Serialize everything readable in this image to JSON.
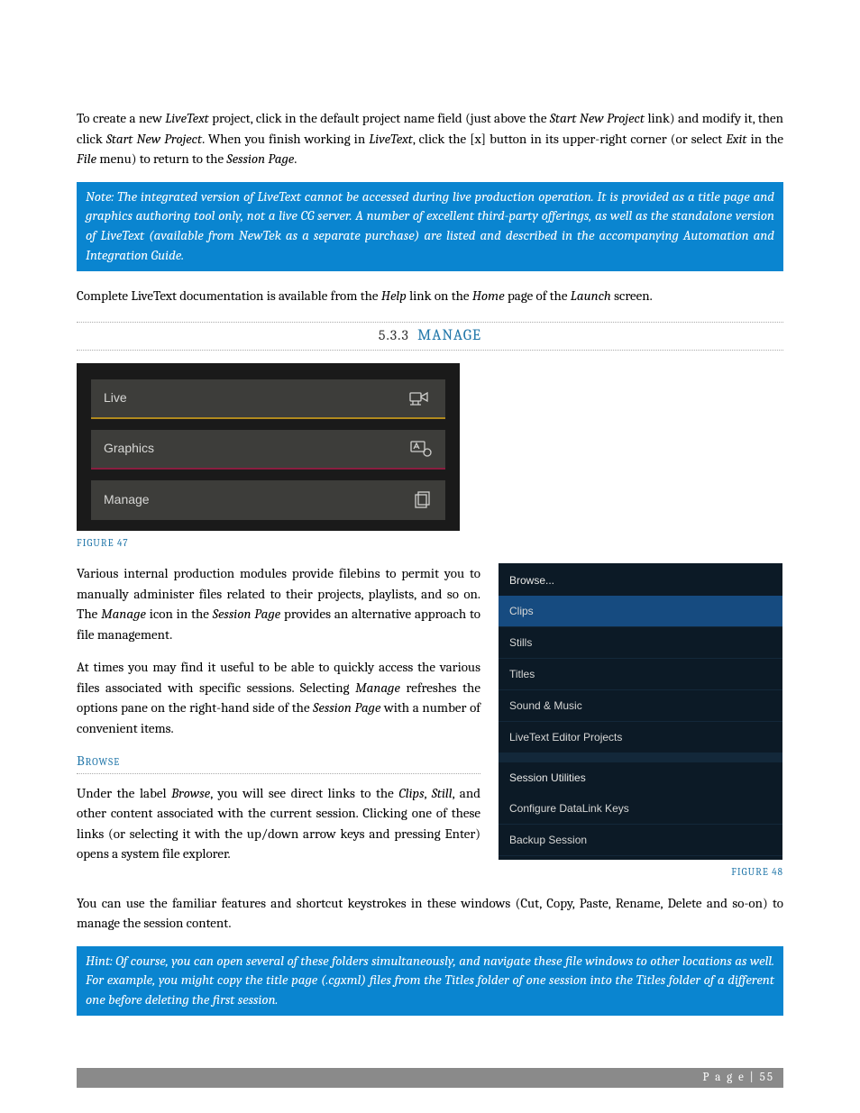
{
  "para1_parts": [
    {
      "t": "To create a new "
    },
    {
      "t": "LiveText",
      "i": true
    },
    {
      "t": " project, click in the default project name field (just above the "
    },
    {
      "t": "Start New Project",
      "i": true
    },
    {
      "t": " link) and modify it, then click "
    },
    {
      "t": "Start New Project",
      "i": true
    },
    {
      "t": ".  When you finish working in "
    },
    {
      "t": "LiveText",
      "i": true
    },
    {
      "t": ", click the [x] button in its upper-right corner (or select "
    },
    {
      "t": "Exit",
      "i": true
    },
    {
      "t": " in the "
    },
    {
      "t": "File",
      "i": true
    },
    {
      "t": " menu) to return to the "
    },
    {
      "t": "Session Page",
      "i": true
    },
    {
      "t": "."
    }
  ],
  "note1": "Note: The integrated version of LiveText cannot be accessed during live production operation.  It is provided as a title page and graphics authoring tool only, not a live CG server. A number of excellent third-party offerings, as well as the standalone version of LiveText (available from NewTek as a separate purchase) are listed and described in the accompanying Automation and Integration Guide.",
  "para2_parts": [
    {
      "t": "Complete LiveText documentation is available from the "
    },
    {
      "t": "Help",
      "i": true
    },
    {
      "t": " link on the "
    },
    {
      "t": "Home",
      "i": true
    },
    {
      "t": " page of the "
    },
    {
      "t": "Launch",
      "i": true
    },
    {
      "t": " screen."
    }
  ],
  "section": {
    "num": "5.3.3",
    "title": "MANAGE"
  },
  "fig47": {
    "rows": [
      {
        "label": "Live",
        "icon": "camera"
      },
      {
        "label": "Graphics",
        "icon": "graphics"
      },
      {
        "label": "Manage",
        "icon": "files"
      }
    ],
    "caption": "FIGURE 47"
  },
  "para3_parts": [
    {
      "t": "Various internal production modules provide filebins to permit you to manually administer files related to their projects, playlists, and so on.  The "
    },
    {
      "t": "Manage",
      "i": true
    },
    {
      "t": " icon in the "
    },
    {
      "t": "Session Page",
      "i": true
    },
    {
      "t": " provides an alternative approach to file management."
    }
  ],
  "para4_parts": [
    {
      "t": "At times you may find it useful to be able to quickly access the various files associated with specific sessions.  Selecting "
    },
    {
      "t": "Manage",
      "i": true
    },
    {
      "t": " refreshes the options pane on the right-hand side of the "
    },
    {
      "t": "Session Page",
      "i": true
    },
    {
      "t": " with a number of convenient items."
    }
  ],
  "browse_head": "Browse",
  "para5_parts": [
    {
      "t": "Under the label "
    },
    {
      "t": "Browse",
      "i": true
    },
    {
      "t": ", you will see direct links to the "
    },
    {
      "t": "Clips",
      "i": true
    },
    {
      "t": ", "
    },
    {
      "t": "Still",
      "i": true
    },
    {
      "t": ", and other content associated with the current session. Clicking one of these links (or selecting it with the up/down arrow keys and pressing Enter) opens a system file explorer."
    }
  ],
  "para6": "You can use the familiar features and shortcut keystrokes in these windows (Cut, Copy, Paste, Rename, Delete and so-on) to manage the session content.",
  "fig48": {
    "header": "Browse...",
    "group1": [
      "Clips",
      "Stills",
      "Titles",
      "Sound & Music",
      "LiveText Editor Projects"
    ],
    "group2_head": "Session Utilities",
    "group2": [
      "Configure DataLink Keys",
      "Backup Session"
    ],
    "selected": "Clips",
    "caption": "FIGURE 48"
  },
  "hint": "Hint: Of course, you can open several of these folders simultaneously, and navigate these file windows to other locations as well. For example, you might copy the title page (.cgxml) files from the Titles folder of one session into the Titles folder of a different one before deleting the first session.",
  "footer": "P a g e  | 55"
}
